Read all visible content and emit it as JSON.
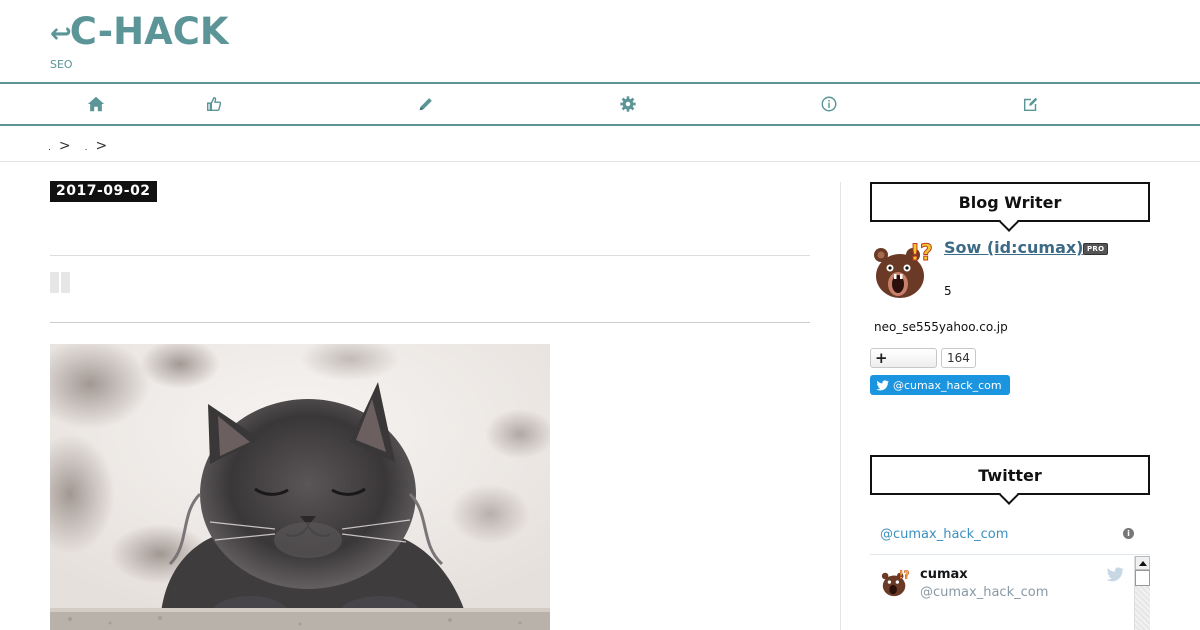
{
  "header": {
    "logo_mark": "↩",
    "logo_text": "C-HACK",
    "tagline": "SEO"
  },
  "nav": {
    "items": [
      {
        "icon": "home-icon"
      },
      {
        "icon": "thumbs-up-icon"
      },
      {
        "icon": "pencil-icon"
      },
      {
        "icon": "gear-icon"
      },
      {
        "icon": "info-icon"
      },
      {
        "icon": "edit-icon"
      }
    ]
  },
  "breadcrumb": {
    "sep": ">"
  },
  "article": {
    "date": "2017-09-02"
  },
  "sidebar": {
    "writer_heading": "Blog Writer",
    "writer_name": "Sow (id:cumax)",
    "pro_badge": "PRO",
    "writer_count": "5",
    "writer_email": "neo_se555yahoo.co.jp",
    "bookmark_count": "164",
    "twitter_follow": "@cumax_hack_com",
    "twitter_heading": "Twitter",
    "twitter_handle_link": "@cumax_hack_com",
    "tweet_name": "cumax",
    "tweet_screen": "@cumax_hack_com"
  },
  "colors": {
    "accent": "#5b9597",
    "link": "#3d6a86",
    "twitter": "#1b95e0"
  }
}
